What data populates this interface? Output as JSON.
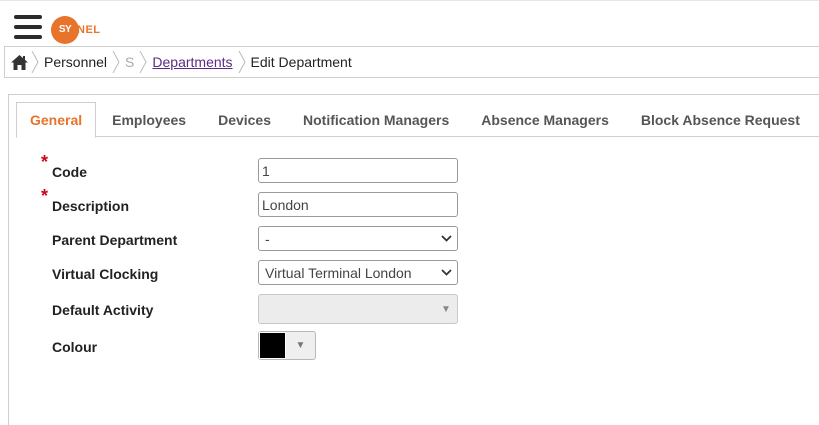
{
  "header": {
    "logo_icon": "synel-logo",
    "logo_circle_text": "SY",
    "logo_rest_text": "NEL",
    "brand_color": "#e8732a"
  },
  "breadcrumb": {
    "home_icon": "home-icon",
    "items": [
      {
        "label": "Personnel",
        "link": false
      },
      {
        "label": "S",
        "link": false
      },
      {
        "label": "Departments",
        "link": true
      },
      {
        "label": "Edit Department",
        "link": false
      }
    ]
  },
  "tabs": [
    {
      "label": "General",
      "active": true
    },
    {
      "label": "Employees",
      "active": false
    },
    {
      "label": "Devices",
      "active": false
    },
    {
      "label": "Notification Managers",
      "active": false
    },
    {
      "label": "Absence Managers",
      "active": false
    },
    {
      "label": "Block Absence Request",
      "active": false
    }
  ],
  "form": {
    "required_marker": "*",
    "code": {
      "label": "Code",
      "value": "1",
      "required": true
    },
    "description": {
      "label": "Description",
      "value": "London",
      "required": true
    },
    "parent_department": {
      "label": "Parent Department",
      "value": "-"
    },
    "virtual_clocking": {
      "label": "Virtual Clocking",
      "value": "Virtual Terminal London"
    },
    "default_activity": {
      "label": "Default Activity",
      "value": "",
      "disabled": true
    },
    "colour": {
      "label": "Colour",
      "value": "#000000"
    }
  },
  "colors": {
    "accent": "#e8732a",
    "link": "#5b2c83",
    "required": "#d0021b"
  }
}
